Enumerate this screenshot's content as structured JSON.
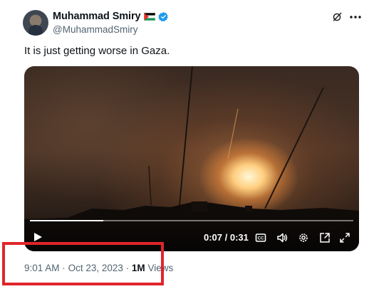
{
  "author": {
    "display_name": "Muhammad Smiry",
    "handle": "@MuhammadSmiry",
    "flag_icon": "palestine-flag-icon",
    "verified_icon": "verified-badge-icon",
    "verified_color": "#1d9bf0"
  },
  "header_icons": [
    "grok-icon",
    "more-icon"
  ],
  "tweet": {
    "text": "It is just getting worse in Gaza."
  },
  "video": {
    "time": "0:07 / 0:31",
    "progress": 0.226,
    "controls": [
      "play-icon",
      "captions-icon",
      "volume-icon",
      "settings-icon",
      "pop-out-icon",
      "fullscreen-icon"
    ]
  },
  "meta": {
    "time": "9:01 AM",
    "separator": "·",
    "date": "Oct 23, 2023",
    "views_count": "1M",
    "views_label": "Views"
  },
  "highlight_color": "#e0252a"
}
